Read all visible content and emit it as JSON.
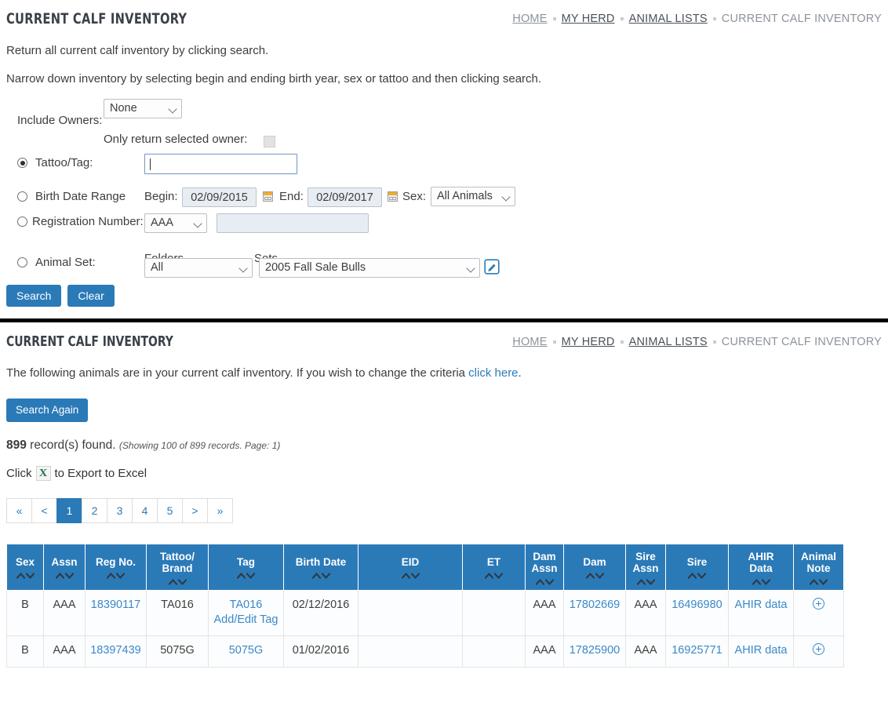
{
  "search_section": {
    "title": "CURRENT CALF INVENTORY",
    "breadcrumb": [
      {
        "label": "HOME",
        "dark": false
      },
      {
        "label": "MY HERD",
        "dark": true
      },
      {
        "label": "ANIMAL LISTS",
        "dark": true
      },
      {
        "label": "CURRENT CALF INVENTORY",
        "dark": false
      }
    ],
    "lead_1": "Return all current calf inventory by clicking search.",
    "lead_2": "Narrow down inventory by selecting begin and ending birth year, sex or tattoo and then clicking search.",
    "include_owners_label": "Include Owners:",
    "include_owners_value": "None",
    "only_selected_owner_label": "Only return selected owner:",
    "tattoo_label": "Tattoo/Tag:",
    "tattoo_value": "",
    "birth_date_label": "Birth Date Range",
    "begin_label": "Begin:",
    "begin_value": "02/09/2015",
    "end_label": "End:",
    "end_value": "02/09/2017",
    "sex_label": "Sex:",
    "sex_value": "All Animals",
    "reg_number_label": "Registration Number:",
    "reg_assn_value": "AAA",
    "reg_number_value": "",
    "animal_set_label": "Animal Set:",
    "folders_label": "Folders",
    "folders_value": "All",
    "sets_label": "Sets",
    "sets_value": "2005 Fall Sale Bulls",
    "search_button": "Search",
    "clear_button": "Clear"
  },
  "results_section": {
    "title": "CURRENT CALF INVENTORY",
    "breadcrumb": [
      {
        "label": "HOME",
        "dark": false
      },
      {
        "label": "MY HERD",
        "dark": true
      },
      {
        "label": "ANIMAL LISTS",
        "dark": true
      },
      {
        "label": "CURRENT CALF INVENTORY",
        "dark": false
      }
    ],
    "intro_prefix": "The following animals are in your current calf inventory. If you wish to change the criteria ",
    "intro_link": "click here",
    "intro_suffix": ".",
    "search_again_button": "Search Again",
    "record_count": "899",
    "record_count_text": " record(s) found. ",
    "record_count_sub": "(Showing 100 of 899 records. Page: 1)",
    "export_prefix": "Click ",
    "export_suffix": " to Export to Excel",
    "pagination": [
      "«",
      "<",
      "1",
      "2",
      "3",
      "4",
      "5",
      ">",
      "»"
    ],
    "pagination_active": "1"
  },
  "table": {
    "columns": [
      "Sex",
      "Assn",
      "Reg No.",
      "Tattoo/ Brand",
      "Tag",
      "Birth Date",
      "EID",
      "ET",
      "Dam Assn",
      "Dam",
      "Sire Assn",
      "Sire",
      "AHIR Data",
      "Animal Note"
    ],
    "rows": [
      {
        "sex": "B",
        "assn": "AAA",
        "reg_no": "18390117",
        "tattoo_brand": "TA016",
        "tag": "TA016",
        "tag_edit": "Add/Edit Tag",
        "birth_date": "02/12/2016",
        "eid": "",
        "et": "",
        "dam_assn": "AAA",
        "dam": "17802669",
        "sire_assn": "AAA",
        "sire": "16496980",
        "ahir_data": "AHIR data",
        "animal_note": "plus-circle-icon"
      },
      {
        "sex": "B",
        "assn": "AAA",
        "reg_no": "18397439",
        "tattoo_brand": "5075G",
        "tag": "5075G",
        "tag_edit": "",
        "birth_date": "01/02/2016",
        "eid": "",
        "et": "",
        "dam_assn": "AAA",
        "dam": "17825900",
        "sire_assn": "AAA",
        "sire": "16925771",
        "ahir_data": "AHIR data",
        "animal_note": "plus-circle-icon"
      }
    ]
  },
  "colors": {
    "accent": "#2b7ab8",
    "link": "#3b88c8",
    "title": "#3a4149",
    "divider": "#000000"
  }
}
